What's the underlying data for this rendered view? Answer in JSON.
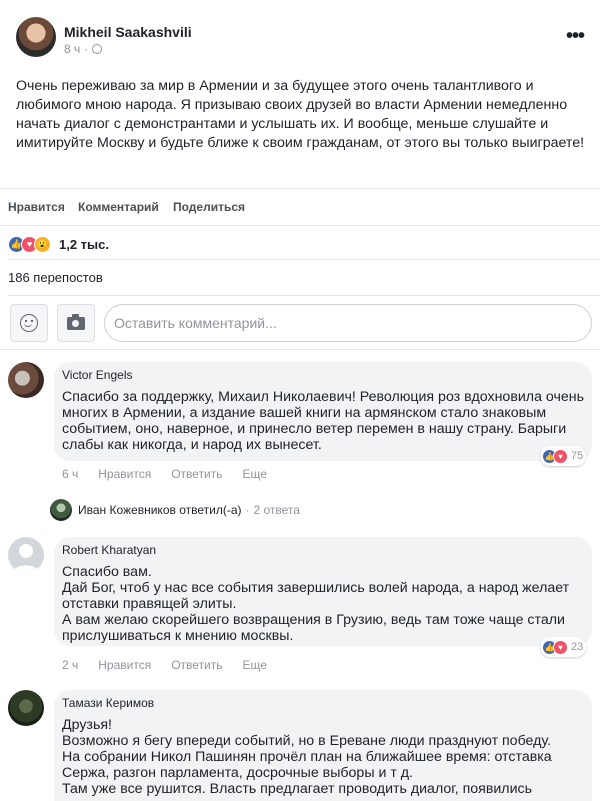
{
  "post": {
    "author": "Mikheil Saakashvili",
    "time": "8 ч",
    "time_separator": "·",
    "text": "Очень переживаю за мир в Армении и за будущее этого очень талантливого и любимого мною народа. Я призываю своих друзей во власти Армении немедленно начать диалог с демонстрантами и услышать их. И вообще, меньше слушайте и имитируйте Москву и будьте ближе к своим гражданам, от этого вы только выиграете!",
    "more_icon": "•••"
  },
  "actions": {
    "like": "Нравится",
    "comment": "Комментарий",
    "share": "Поделиться"
  },
  "reactions": {
    "icons": [
      "like-icon",
      "love-icon",
      "wow-icon"
    ],
    "count": "1,2 тыс."
  },
  "shares": "186 перепостов",
  "composer": {
    "placeholder": "Оставить комментарий..."
  },
  "comments": [
    {
      "name": "Victor Engels",
      "text": "Спасибо за поддержку, Михаил Николаевич! Революция роз вдохновила очень многих в Армении, а издание вашей книги на армянском стало знаковым событием, оно, наверное, и принесло ветер перемен в нашу страну. Барыги слабы как никогда, и народ их вынесет.",
      "reaction_count": "75",
      "time": "6 ч",
      "like": "Нравится",
      "reply": "Ответить",
      "more": "Еще"
    },
    {
      "name": "Robert Kharatyan",
      "text": "Спасибо вам.\nДай Бог, чтоб у нас все события завершились волей народа, а народ желает отставки правящей элиты.\nА вам желаю скорейшего возвращения в Грузию, ведь там тоже чаще стали прислушиваться к мнению москвы.",
      "reaction_count": "23",
      "time": "2 ч",
      "like": "Нравится",
      "reply": "Ответить",
      "more": "Еще"
    },
    {
      "name": "Тамази Керимов",
      "text": "Друзья!\nВозможно я бегу впереди событий, но в Ереване люди празднуют победу.\nНа собрании Никол Пашинян прочёл план на ближайшее время: отставка Сержа, разгон парламента, досрочные выборы и т д.\nТам уже все рушится. Власть предлагает проводить диалог, появились"
    }
  ],
  "reply_summary": {
    "name": "Иван Кожевников ответил(-а)",
    "separator": "·",
    "count": "2 ответа"
  },
  "colors": {
    "like_blue": "#4267b2",
    "love_red": "#f25268",
    "wow_yellow": "#f7b125",
    "bubble_bg": "#f2f3f5",
    "meta_gray": "#90949c"
  }
}
